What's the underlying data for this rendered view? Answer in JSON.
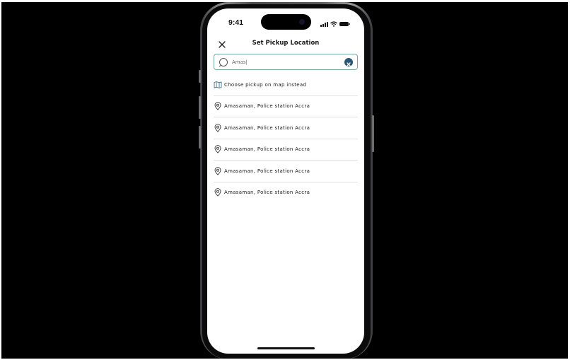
{
  "status_bar": {
    "time": "9:41"
  },
  "header": {
    "title": "Set Pickup Location",
    "close_icon": "close-icon"
  },
  "search": {
    "value": "Amas|",
    "search_icon": "search-icon",
    "clear_icon": "clear-circle-icon",
    "border_color": "#79a7a4",
    "clear_color": "#2b5673"
  },
  "map_option": {
    "label": "Choose pickup on map instead",
    "icon": "map-icon"
  },
  "results": [
    {
      "label": "Amasaman, Police station Accra",
      "icon": "location-pin-icon"
    },
    {
      "label": "Amasaman, Police station Accra",
      "icon": "location-pin-icon"
    },
    {
      "label": "Amasaman, Police station Accra",
      "icon": "location-pin-icon"
    },
    {
      "label": "Amasaman, Police station Accra",
      "icon": "location-pin-icon"
    },
    {
      "label": "Amasaman, Police station Accra",
      "icon": "location-pin-icon"
    }
  ]
}
